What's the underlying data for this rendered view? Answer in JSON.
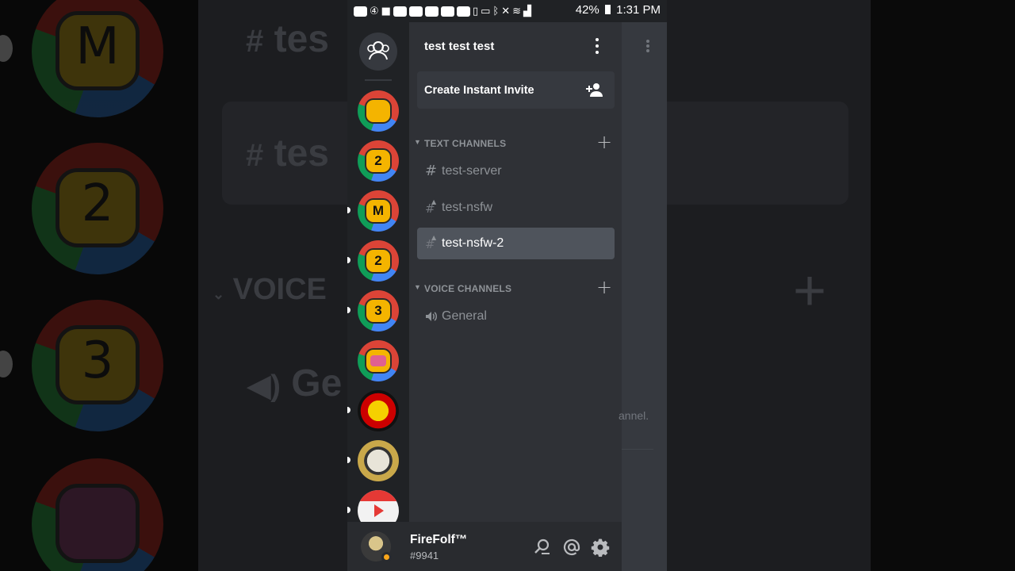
{
  "status_bar": {
    "battery": "42%",
    "time": "1:31 PM"
  },
  "server": {
    "name": "test test test"
  },
  "invite": {
    "label": "Create Instant Invite"
  },
  "text_category": {
    "label": "TEXT CHANNELS"
  },
  "voice_category": {
    "label": "VOICE CHANNELS"
  },
  "text_channels": [
    {
      "name": "test-server",
      "icon": "hash-icon",
      "nsfw": false,
      "active": false
    },
    {
      "name": "test-nsfw",
      "icon": "nsfw-hash-icon",
      "nsfw": true,
      "active": false
    },
    {
      "name": "test-nsfw-2",
      "icon": "nsfw-hash-icon",
      "nsfw": true,
      "active": true
    }
  ],
  "voice_channels": [
    {
      "name": "General",
      "icon": "speaker-icon"
    }
  ],
  "guilds": [
    {
      "glyph": "",
      "unread": false
    },
    {
      "glyph": "2",
      "unread": false
    },
    {
      "glyph": "M",
      "unread": true
    },
    {
      "glyph": "2",
      "unread": true
    },
    {
      "glyph": "3",
      "unread": true
    },
    {
      "glyph": "",
      "unread": false
    },
    {
      "glyph": "",
      "unread": true
    },
    {
      "glyph": "",
      "unread": true
    },
    {
      "glyph": "",
      "unread": true
    }
  ],
  "user": {
    "name": "FireFolf™",
    "discriminator": "#9941",
    "status": "idle"
  },
  "background": {
    "chat_tail": "annel.",
    "ghost_voice": "VOICE",
    "ghost_channel_1": "tes",
    "ghost_channel_2": "tes",
    "ghost_general": "Ge",
    "big_glyphs": [
      "M",
      "2",
      "3",
      ""
    ]
  },
  "colors": {
    "accent_idle": "#faa61a",
    "active_channel": "#4f545c",
    "pane": "#2f3136",
    "rail": "#202225"
  }
}
